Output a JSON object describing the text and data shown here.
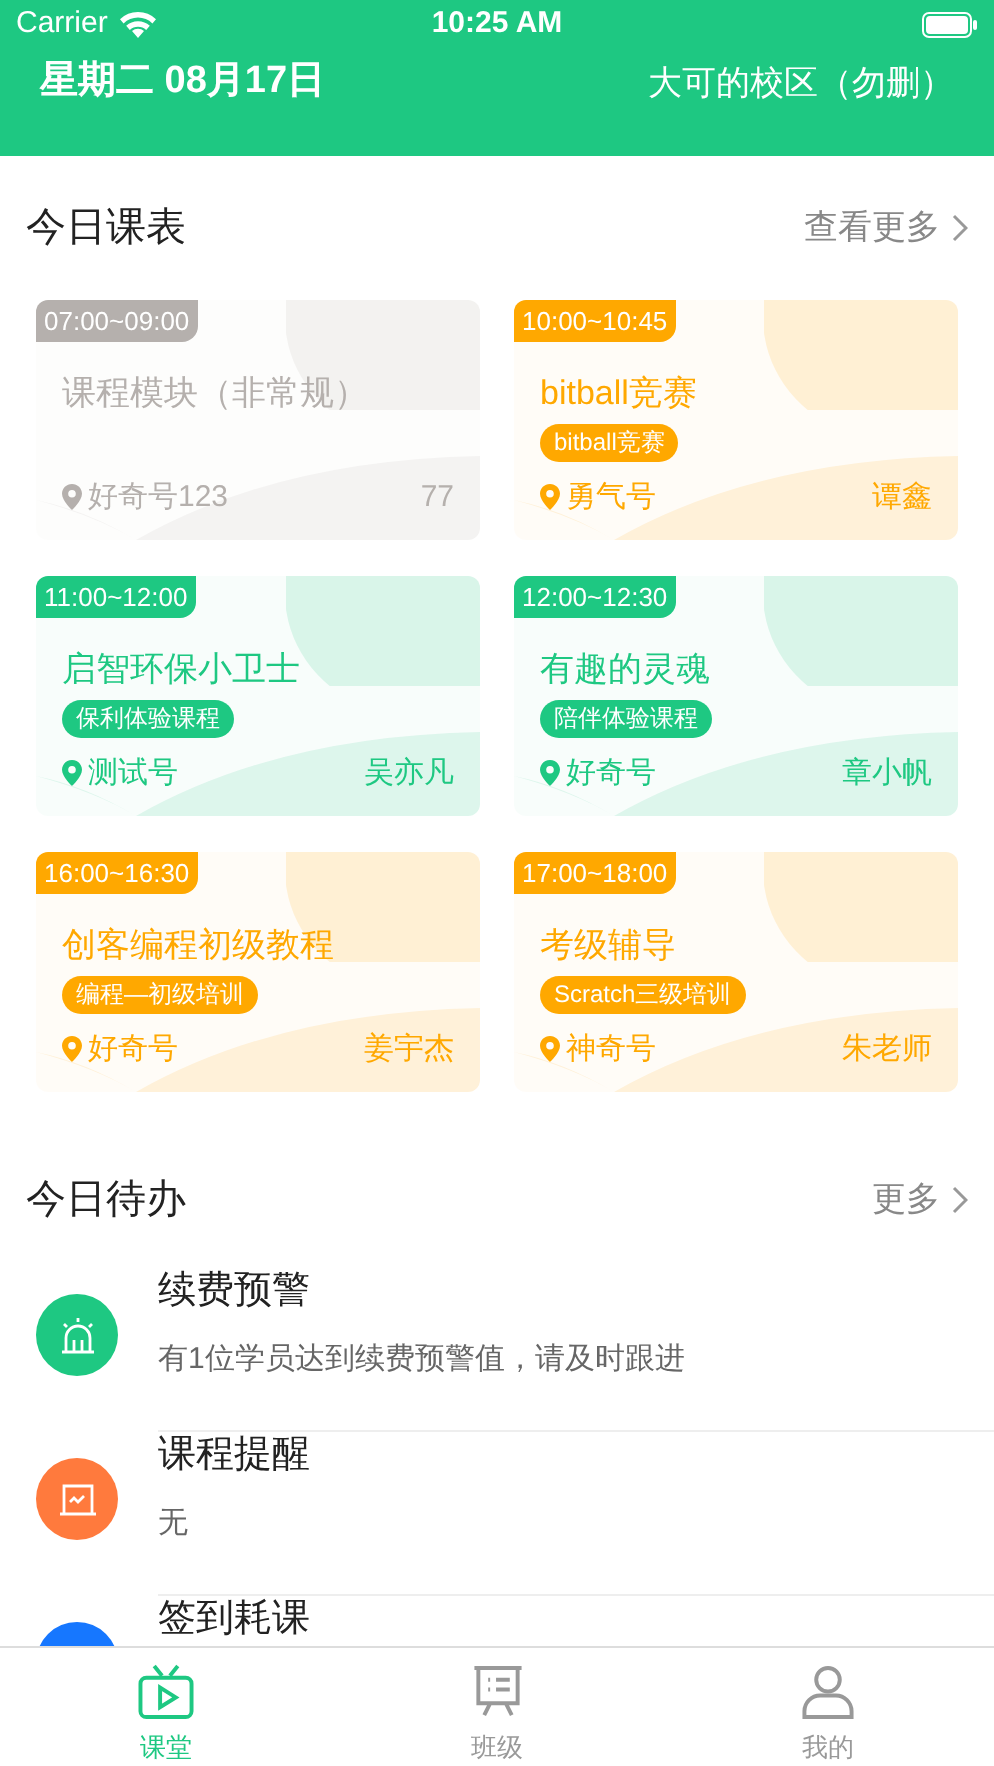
{
  "status_bar": {
    "carrier": "Carrier",
    "time": "10:25 AM"
  },
  "header": {
    "date": "星期二 08月17日",
    "campus": "大可的校区（勿删）"
  },
  "schedule": {
    "title": "今日课表",
    "more": "查看更多",
    "cards": [
      {
        "time": "07:00~09:00",
        "name": "课程模块（非常规）",
        "location": "好奇号123",
        "teacher": "77",
        "color": "#b5b0ad"
      },
      {
        "time": "10:00~10:45",
        "name": "bitball竞赛",
        "tag": "bitball竞赛",
        "location": "勇气号",
        "teacher": "谭鑫",
        "color": "#ffa800"
      },
      {
        "time": "11:00~12:00",
        "name": "启智环保小卫士",
        "tag": "保利体验课程",
        "location": "测试号",
        "teacher": "吴亦凡",
        "color": "#1ec882"
      },
      {
        "time": "12:00~12:30",
        "name": "有趣的灵魂",
        "tag": "陪伴体验课程",
        "location": "好奇号",
        "teacher": "章小帆",
        "color": "#1ec882"
      },
      {
        "time": "16:00~16:30",
        "name": "创客编程初级教程",
        "tag": "编程—初级培训",
        "location": "好奇号",
        "teacher": "姜宇杰",
        "color": "#ffa800"
      },
      {
        "time": "17:00~18:00",
        "name": "考级辅导",
        "tag": "Scratch三级培训",
        "location": "神奇号",
        "teacher": "朱老师",
        "color": "#ffa800"
      }
    ]
  },
  "todo": {
    "title": "今日待办",
    "more": "更多",
    "items": [
      {
        "kind": "alarm",
        "title": "续费预警",
        "detail": "有1位学员达到续费预警值，请及时跟进",
        "color": "#1ec882"
      },
      {
        "kind": "board",
        "title": "课程提醒",
        "detail": "无",
        "color": "#ff7a3d"
      },
      {
        "kind": "signin",
        "title": "签到耗课",
        "color": "#1677ff"
      }
    ]
  },
  "tab_bar": [
    {
      "kind": "tv",
      "label": "课堂",
      "selected": true
    },
    {
      "kind": "board",
      "label": "班级",
      "selected": false
    },
    {
      "kind": "person",
      "label": "我的",
      "selected": false
    }
  ]
}
